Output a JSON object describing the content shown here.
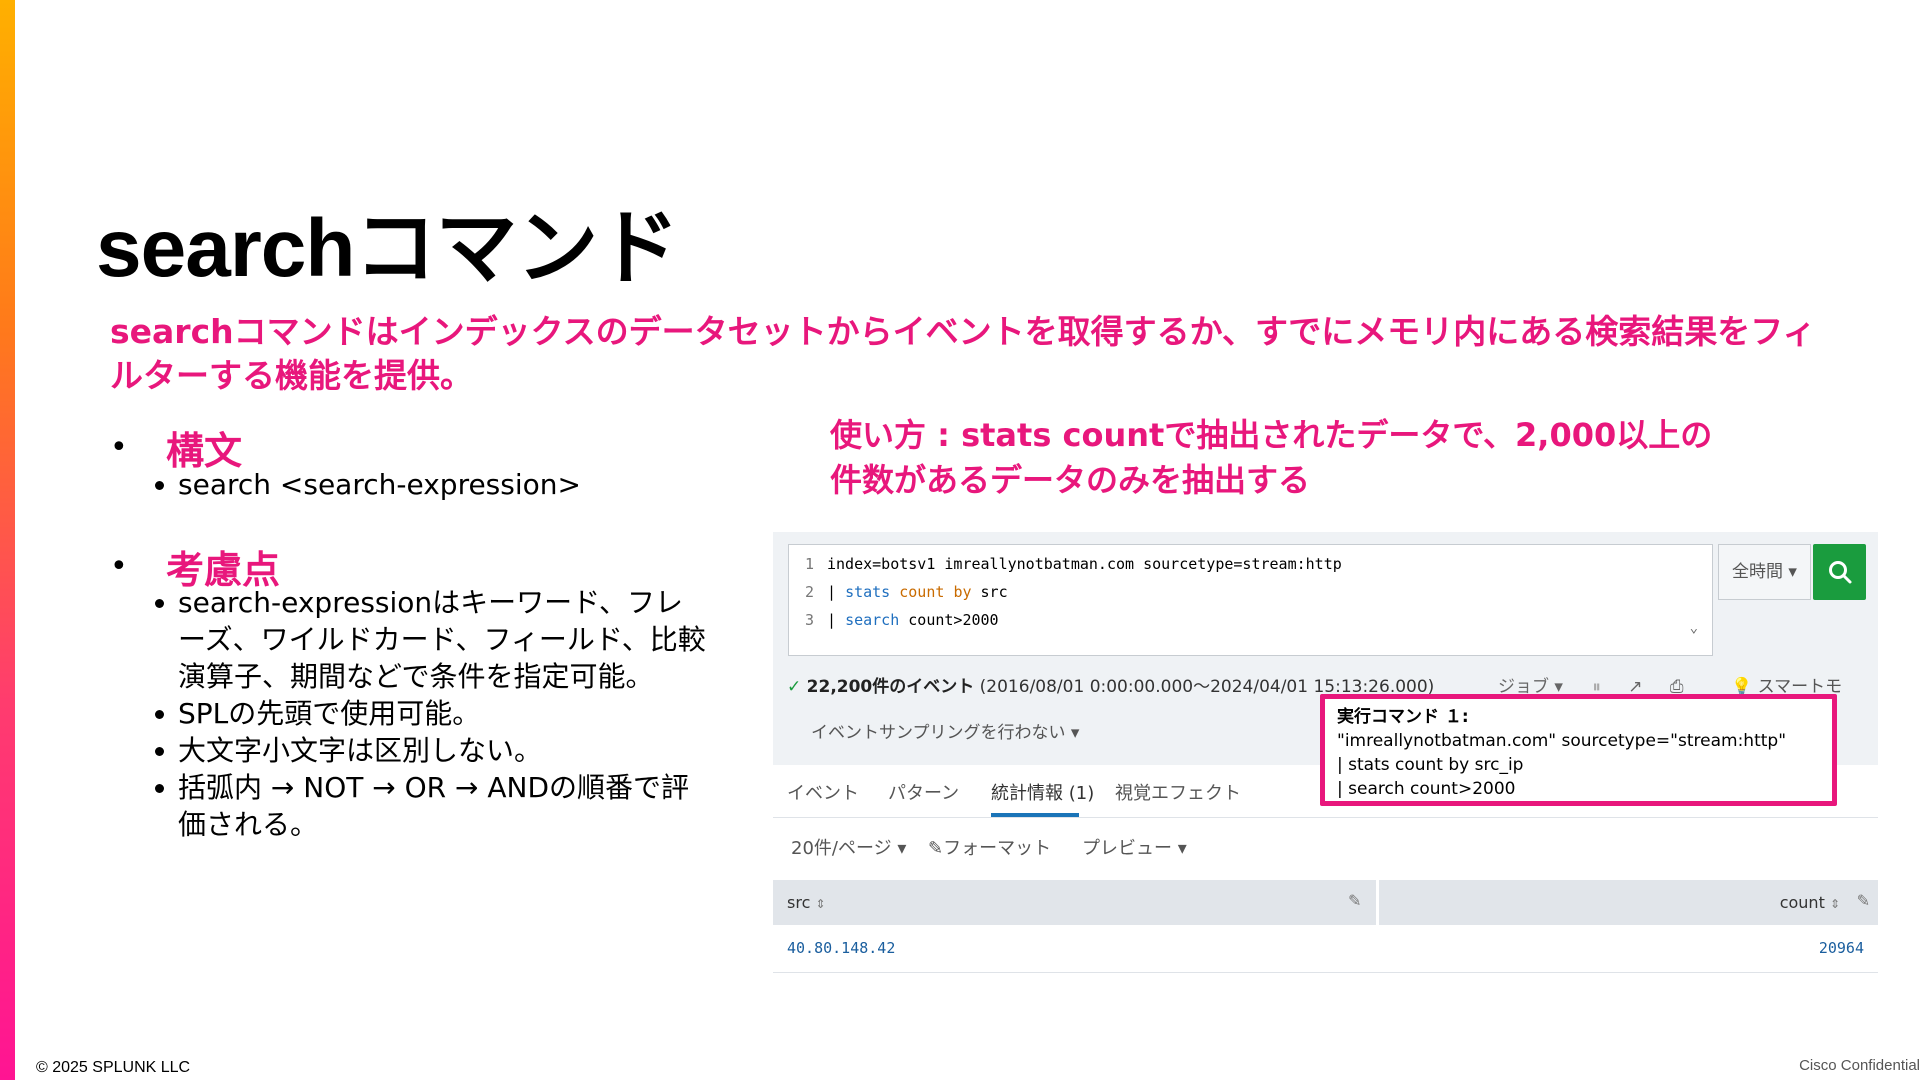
{
  "slide": {
    "title": "searchコマンド",
    "intro": "searchコマンドはインデックスのデータセットからイベントを取得するか、すでにメモリ内にある検索結果をフィルターする機能を提供。",
    "syntax_heading": "構文",
    "syntax_items": [
      "search <search-expression>"
    ],
    "notes_heading": "考慮点",
    "notes_items": [
      "search-expressionはキーワード、フレーズ、ワイルドカード、フィールド、比較演算子、期間などで条件を指定可能。",
      "SPLの先頭で使用可能。",
      "大文字小文字は区別しない。",
      "括弧内 → NOT → OR → ANDの順番で評価される。"
    ],
    "usage_line1": "使い方 : stats countで抽出されたデータで、2,000以上の",
    "usage_line2": "件数があるデータのみを抽出する"
  },
  "splunk": {
    "code": [
      {
        "num": "1",
        "parts": [
          {
            "t": "index=botsv1 imreallynotbatman.com sourcetype=stream:http",
            "c": ""
          }
        ]
      },
      {
        "num": "2",
        "parts": [
          {
            "t": "| ",
            "c": ""
          },
          {
            "t": "stats",
            "c": "kw-blue"
          },
          {
            "t": " ",
            "c": ""
          },
          {
            "t": "count",
            "c": "kw-orange"
          },
          {
            "t": " ",
            "c": ""
          },
          {
            "t": "by",
            "c": "kw-orange"
          },
          {
            "t": " src",
            "c": ""
          }
        ]
      },
      {
        "num": "3",
        "parts": [
          {
            "t": "| ",
            "c": ""
          },
          {
            "t": "search",
            "c": "kw-blue"
          },
          {
            "t": " count>2000",
            "c": ""
          }
        ]
      }
    ],
    "time_picker": "全時間 ▾",
    "events_check": "✓",
    "events_count": "22,200件のイベント",
    "events_range": "(2016/08/01 0:00:00.000～2024/04/01 15:13:26.000)",
    "job_label": "ジョブ ▾",
    "smart_mode": "スマートモ",
    "sampling": "イベントサンプリングを行わない ▾",
    "tabs": [
      "イベント",
      "パターン",
      "統計情報 (1)",
      "視覚エフェクト"
    ],
    "per_page": "20件/ページ ▾",
    "format": "フォーマット",
    "preview": "プレビュー ▾",
    "col_src": "src",
    "col_count": "count",
    "row_src": "40.80.148.42",
    "row_count": "20964"
  },
  "callout": {
    "title": "実行コマンド １:",
    "lines": [
      "\"imreallynotbatman.com\" sourcetype=\"stream:http\"",
      "| stats count by src_ip",
      "| search count>2000"
    ]
  },
  "footer": {
    "copyright": "© 2025 SPLUNK LLC",
    "confidential": "Cisco Confidential"
  }
}
